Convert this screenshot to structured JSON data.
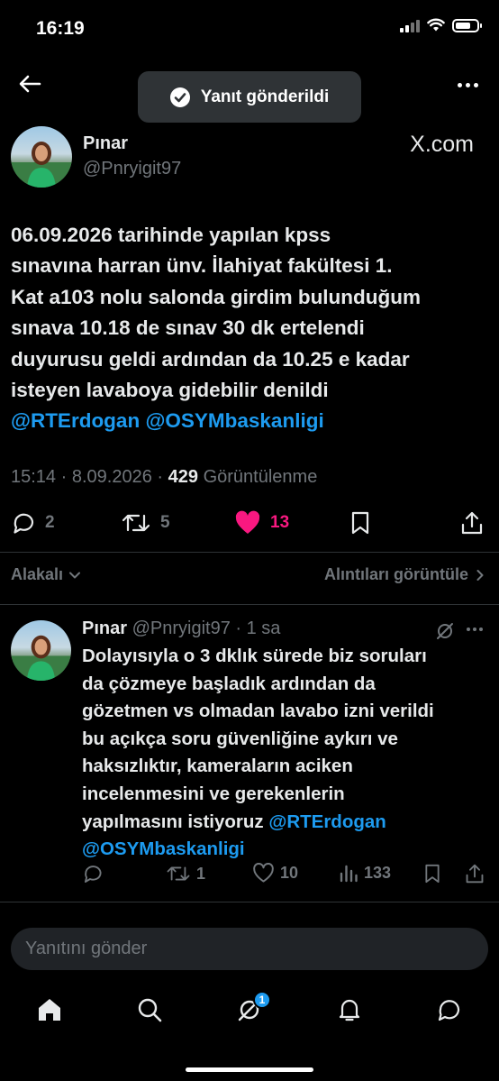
{
  "status_bar": {
    "time": "16:19"
  },
  "toast": {
    "text": "Yanıt gönderildi"
  },
  "tweet": {
    "author_name": "Pınar",
    "author_handle": "@Pnryigit97",
    "brand": "X.com",
    "text_lines": [
      "06.09.2026 tarihinde yapılan kpss",
      "sınavına harran ünv. İlahiyat fakültesi 1.",
      "Kat a103 nolu salonda girdim bulunduğum",
      "sınava 10.18 de sınav 30 dk ertelendi",
      "duyurusu geldi ardından da 10.25 e kadar",
      "isteyen lavaboya gidebilir denildi"
    ],
    "mentions": [
      "@RTErdogan",
      "@OSYMbaskanligi"
    ],
    "time": "15:14",
    "date": "8.09.2026",
    "separator": "·",
    "views_count": "429",
    "views_label": "Görüntülenme",
    "replies": "2",
    "retweets": "5",
    "likes": "13"
  },
  "filters": {
    "sort_label": "Alakalı",
    "quotes_label": "Alıntıları görüntüle"
  },
  "reply": {
    "author_name": "Pınar",
    "author_handle": "@Pnryigit97",
    "time_ago": "· 1 sa",
    "text_lines": [
      "Dolayısıyla o 3 dklık sürede biz soruları",
      "da çözmeye başladık ardından da",
      "gözetmen vs olmadan lavabo izni verildi",
      "bu açıkça soru güvenliğine aykırı ve",
      "haksızlıktır, kameraların aciken",
      "incelenmesini ve gerekenlerin"
    ],
    "line7_text": "yapılmasını istiyoruz ",
    "mentions": [
      "@RTErdogan",
      "@OSYMbaskanligi"
    ],
    "replies": "",
    "retweets": "1",
    "likes": "10",
    "views": "133"
  },
  "composer": {
    "placeholder": "Yanıtını gönder"
  },
  "bottom_nav": {
    "grok_badge": "1"
  },
  "colors": {
    "background": "#000000",
    "text": "#e7e9ea",
    "muted": "#71767b",
    "accent": "#1d9bf0",
    "like": "#f91880",
    "divider": "#2f3336"
  },
  "icons": [
    "back-arrow-icon",
    "check-circle-icon",
    "more-icon",
    "reply-icon",
    "retweet-icon",
    "heart-icon",
    "bookmark-icon",
    "share-icon",
    "chevron-down-icon",
    "chevron-right-icon",
    "grok-icon",
    "views-icon",
    "home-icon",
    "search-icon",
    "bell-icon",
    "messages-icon"
  ]
}
